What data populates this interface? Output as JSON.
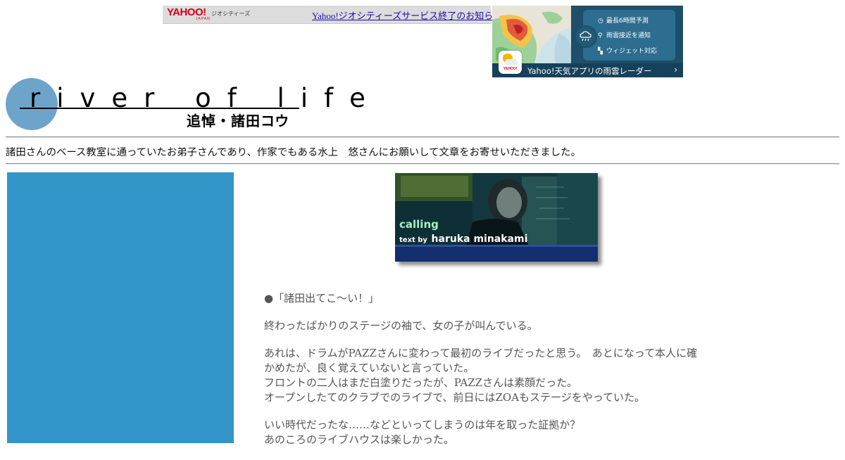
{
  "geocities_bar": {
    "logo": "YAHOO!",
    "logo_japan": "JAPAN",
    "service_name": "ジオシティーズ",
    "notice_link": "Yahoo!ジオシティーズサービス終了のお知らせ"
  },
  "weather_ad": {
    "features": [
      {
        "icon": "clock-icon",
        "label": "最長6時間予測"
      },
      {
        "icon": "pin-icon",
        "label": "雨雲接近を通知"
      },
      {
        "icon": "widget-icon",
        "label": "ウィジェット対応"
      }
    ],
    "footer_text": "Yahoo!天気アプリの雨雲レーダー",
    "footer_arrow": "›",
    "app_icon_label": "YAHOO!"
  },
  "header": {
    "title": "river of life",
    "subtitle": "追悼・諸田コウ"
  },
  "intro_text": "諸田さんのベース教室に通っていたお弟子さんであり、作家でもある水上　悠さんにお願いして文章をお寄せいただきました。",
  "banner": {
    "label": "calling",
    "by_prefix": "text by",
    "author": "haruka minakami"
  },
  "article": {
    "paragraphs": [
      [
        "●「諸田出てこ～い！」"
      ],
      [
        "終わったばかりのステージの袖で、女の子が叫んでいる。"
      ],
      [
        "あれは、ドラムがPAZZさんに変わって最初のライブだったと思う。　あとになって本人に確",
        "かめたが、良く覚えていないと言っていた。",
        "フロントの二人はまだ白塗りだったが、PAZZさんは素顔だった。",
        "オープンしたてのクラブでのライブで、前日にはZOAもステージをやっていた。"
      ],
      [
        "いい時代だったな……などといってしまうのは年を取った証拠か？",
        "あのころのライブハウスは楽しかった。"
      ]
    ]
  },
  "colors": {
    "sidebar": "#3394c7",
    "logo_circle": "#6ea4c9",
    "link": "#1a0dab",
    "article_text": "#555555"
  }
}
